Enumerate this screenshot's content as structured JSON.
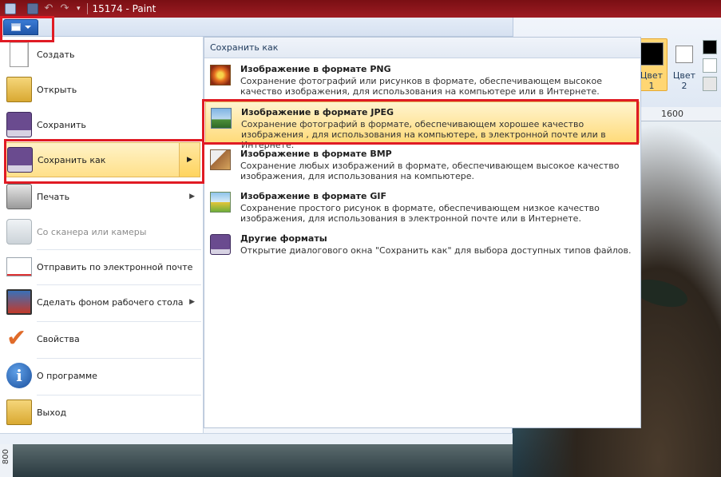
{
  "window": {
    "title": "15174 - Paint",
    "qa_dropdown": "▾"
  },
  "ribbon": {
    "color1_label": "Цвет\n1",
    "color1_line1": "Цвет",
    "color1_line2": "1",
    "color2_line1": "Цвет",
    "color2_line2": "2",
    "ruler_top_value": "1600",
    "ruler_left_value": "800"
  },
  "app_menu": {
    "items": [
      {
        "label": "Создать",
        "icon": "new-document-icon"
      },
      {
        "label": "Открыть",
        "icon": "open-folder-icon"
      },
      {
        "label": "Сохранить",
        "icon": "save-disk-icon"
      },
      {
        "label": "Сохранить как",
        "icon": "save-as-icon",
        "has_submenu": true
      },
      {
        "label": "Печать",
        "icon": "printer-icon",
        "has_submenu": true
      },
      {
        "label": "Со сканера или камеры",
        "icon": "scanner-icon",
        "disabled": true
      },
      {
        "label": "Отправить по электронной почте",
        "icon": "email-icon"
      },
      {
        "label": "Сделать фоном рабочего стола",
        "icon": "desktop-background-icon",
        "has_submenu": true
      },
      {
        "label": "Свойства",
        "icon": "properties-check-icon"
      },
      {
        "label": "О программе",
        "icon": "info-icon"
      },
      {
        "label": "Выход",
        "icon": "exit-icon"
      }
    ]
  },
  "submenu": {
    "title": "Сохранить как",
    "items": [
      {
        "title": "Изображение в формате PNG",
        "description": "Сохранение фотографий или рисунков в формате, обеспечивающем высокое качество изображения, для использования на компьютере или в Интернете.",
        "icon": "png-format-icon"
      },
      {
        "title": "Изображение в формате JPEG",
        "description": "Сохранение фотографий в формате, обеспечивающем хорошее качество изображения , для использования на компьютере, в электронной почте или в Интернете.",
        "icon": "jpeg-format-icon"
      },
      {
        "title": "Изображение в формате BMP",
        "description": "Сохранение любых изображений в формате, обеспечивающем высокое качество изображения, для использования на компьютере.",
        "icon": "bmp-format-icon"
      },
      {
        "title": "Изображение в формате GIF",
        "description": "Сохранение простого рисунок в формате, обеспечивающем низкое качество изображения, для использования в электронной почте или в Интернете.",
        "icon": "gif-format-icon"
      },
      {
        "title": "Другие форматы",
        "description": "Открытие диалогового окна \"Сохранить как\" для выбора доступных типов файлов.",
        "icon": "other-formats-icon"
      }
    ]
  },
  "colors": {
    "highlight_border": "#e01b24",
    "title_bar": "#9e1c22",
    "hover": "#ffe08a"
  }
}
